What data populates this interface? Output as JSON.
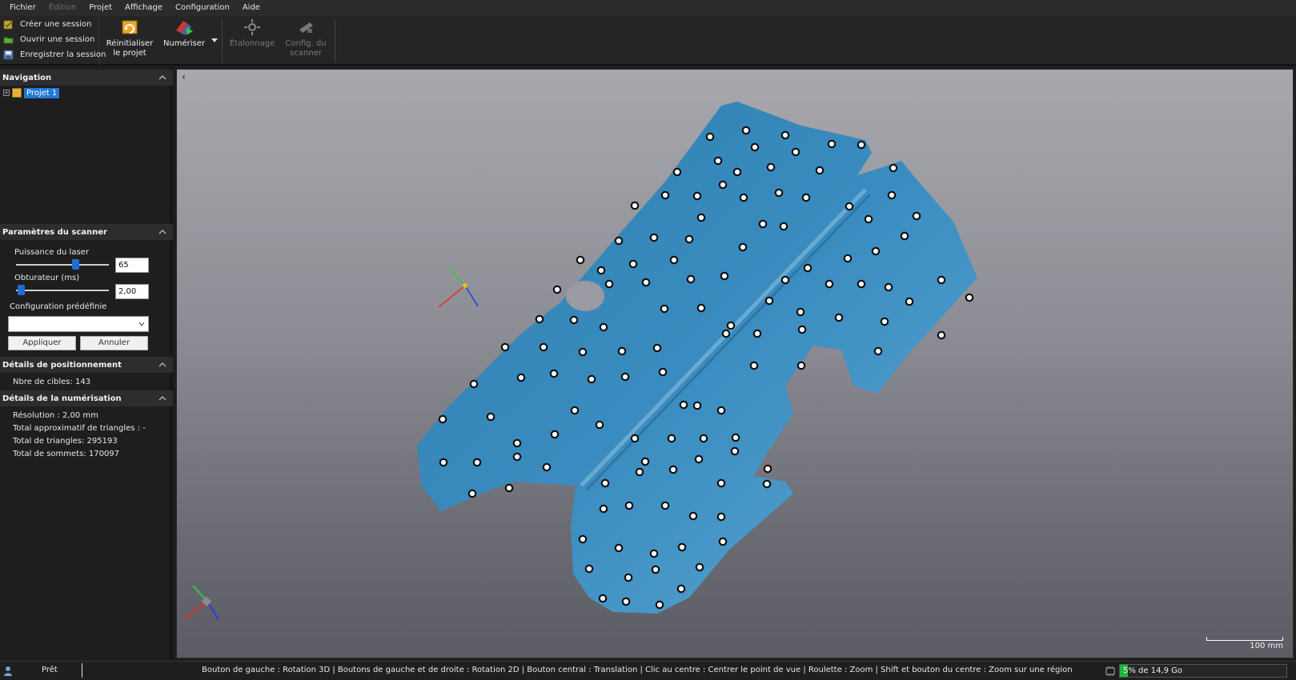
{
  "menu": {
    "items": [
      {
        "label": "Fichier",
        "enabled": true
      },
      {
        "label": "Édition",
        "enabled": false
      },
      {
        "label": "Projet",
        "enabled": true
      },
      {
        "label": "Affichage",
        "enabled": true
      },
      {
        "label": "Configuration",
        "enabled": true
      },
      {
        "label": "Aide",
        "enabled": true
      }
    ]
  },
  "ribbon": {
    "session": {
      "create": "Créer une session",
      "open": "Ouvrir une session",
      "save": "Enregistrer la session"
    },
    "reset": {
      "line1": "Réinitialiser",
      "line2": "le projet"
    },
    "scan": "Numériser",
    "calibration": "Étalonnage",
    "scanner_config": {
      "line1": "Config. du",
      "line2": "scanner"
    }
  },
  "navigation": {
    "title": "Navigation",
    "project": "Projet 1"
  },
  "scanner_params": {
    "title": "Paramètres du scanner",
    "laser_label": "Puissance du laser",
    "laser_value": "65",
    "laser_level": 0.65,
    "shutter_label": "Obturateur (ms)",
    "shutter_value": "2,00",
    "shutter_level": 0.02,
    "preset_label": "Configuration prédéfinie",
    "preset_value": "",
    "apply": "Appliquer",
    "cancel": "Annuler"
  },
  "positioning": {
    "title": "Détails de positionnement",
    "targets": "Nbre de cibles: 143"
  },
  "digitization": {
    "title": "Détails de la numérisation",
    "resolution": "Résolution : 2,00 mm",
    "approx_triangles": "Total approximatif de triangles : -",
    "triangles": "Total de triangles: 295193",
    "vertices": "Total de sommets: 170097"
  },
  "viewport": {
    "scale_label": "100 mm",
    "mesh_color": "#3a8ab8",
    "background_top": "#a8a8ae",
    "background_bottom": "#5c5c64"
  },
  "status": {
    "ready": "Prêt",
    "hint": "Bouton de gauche : Rotation 3D  |  Boutons de gauche et de droite : Rotation 2D  |  Bouton central : Translation  |  Clic au centre : Centrer le point de vue  |  Roulette : Zoom  |  Shift et bouton du centre : Zoom sur une région",
    "memory": "5% de 14,9 Go",
    "memory_fraction": 0.05
  }
}
